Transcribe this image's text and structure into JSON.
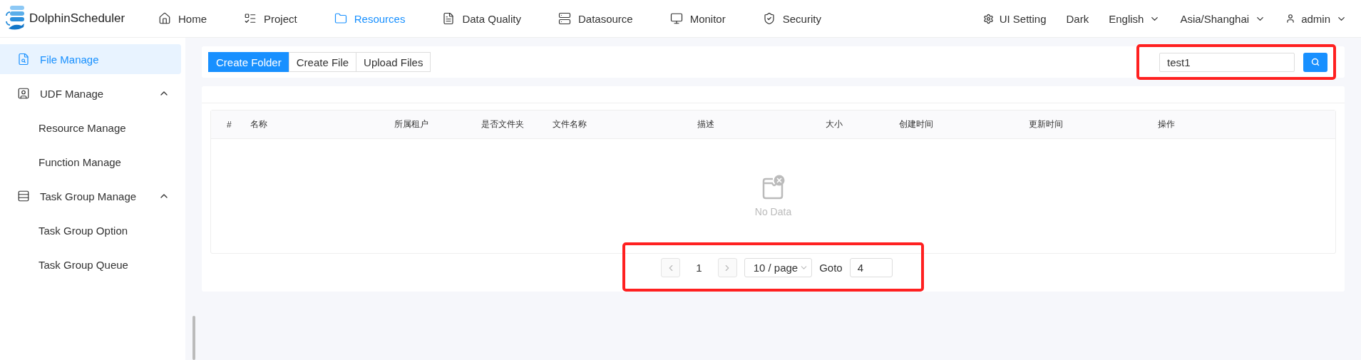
{
  "app": {
    "name": "DolphinScheduler"
  },
  "nav": [
    {
      "label": "Home",
      "selected": false
    },
    {
      "label": "Project",
      "selected": false
    },
    {
      "label": "Resources",
      "selected": true
    },
    {
      "label": "Data Quality",
      "selected": false
    },
    {
      "label": "Datasource",
      "selected": false
    },
    {
      "label": "Monitor",
      "selected": false
    },
    {
      "label": "Security",
      "selected": false
    }
  ],
  "header_right": {
    "ui_setting": "UI Setting",
    "theme": "Dark",
    "language": "English",
    "timezone": "Asia/Shanghai",
    "user": "admin"
  },
  "sidebar": {
    "items": [
      {
        "label": "File Manage",
        "selected": true
      },
      {
        "label": "UDF Manage",
        "selected": false,
        "expanded": true,
        "children": [
          {
            "label": "Resource Manage",
            "selected": false
          },
          {
            "label": "Function Manage",
            "selected": false
          }
        ]
      },
      {
        "label": "Task Group Manage",
        "selected": false,
        "expanded": true,
        "children": [
          {
            "label": "Task Group Option",
            "selected": false
          },
          {
            "label": "Task Group Queue",
            "selected": false
          }
        ]
      }
    ]
  },
  "toolbar": {
    "buttons": [
      {
        "label": "Create Folder",
        "primary": true
      },
      {
        "label": "Create File",
        "primary": false
      },
      {
        "label": "Upload Files",
        "primary": false
      }
    ],
    "search": {
      "value": "test1"
    },
    "highlighted": true
  },
  "table": {
    "columns": [
      "#",
      "名称",
      "所属租户",
      "是否文件夹",
      "文件名称",
      "描述",
      "大小",
      "创建时间",
      "更新时间",
      "操作"
    ],
    "empty_text": "No Data"
  },
  "pagination": {
    "page": "1",
    "page_size": "10 / page",
    "goto_label": "Goto",
    "goto_value": "4",
    "highlighted": true
  }
}
